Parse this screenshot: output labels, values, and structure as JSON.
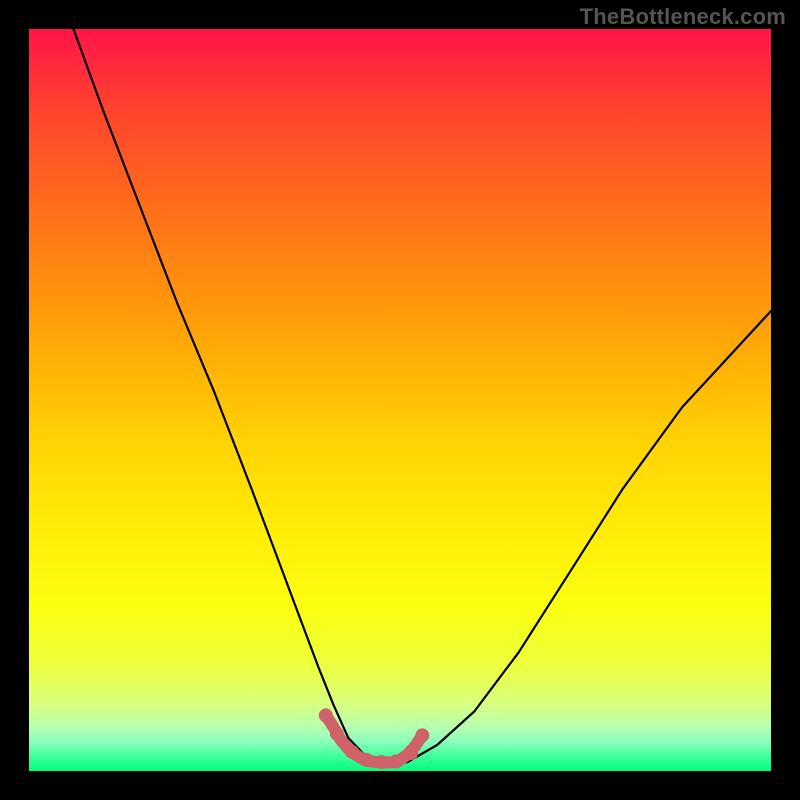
{
  "watermark": "TheBottleneck.com",
  "chart_data": {
    "type": "line",
    "title": "",
    "xlabel": "",
    "ylabel": "",
    "xlim": [
      0,
      100
    ],
    "ylim": [
      0,
      100
    ],
    "grid": false,
    "legend": false,
    "series": [
      {
        "name": "black-curve",
        "color": "#000000",
        "x": [
          6,
          10,
          15,
          20,
          25,
          30,
          33,
          36,
          39,
          41,
          43,
          45,
          47,
          49,
          51,
          55,
          60,
          66,
          73,
          80,
          88,
          100
        ],
        "y": [
          100,
          89,
          76,
          63,
          51,
          38,
          30,
          22,
          14,
          9,
          4.5,
          2.4,
          1.2,
          1.0,
          1.2,
          3.5,
          8,
          16,
          27,
          38,
          49,
          62
        ]
      },
      {
        "name": "red-overlay",
        "color": "#cf6168",
        "x": [
          40,
          41,
          42,
          43,
          44,
          45,
          46,
          47,
          48,
          49,
          50,
          51,
          52,
          53
        ],
        "y": [
          7.5,
          6.0,
          4.2,
          3.0,
          2.2,
          1.6,
          1.3,
          1.2,
          1.15,
          1.2,
          1.5,
          2.2,
          3.3,
          4.8
        ]
      }
    ],
    "overlay_points": {
      "name": "red-dots",
      "color": "#cf6168",
      "x": [
        40,
        41.5,
        43.5,
        45.5,
        47.5,
        49.5,
        51.5,
        53
      ],
      "y": [
        7.5,
        5.0,
        2.6,
        1.5,
        1.2,
        1.3,
        2.4,
        4.8
      ]
    },
    "gradient_stops": [
      {
        "pos": 0,
        "color": "#ff144a"
      },
      {
        "pos": 25,
        "color": "#ff7018"
      },
      {
        "pos": 55,
        "color": "#ffd104"
      },
      {
        "pos": 80,
        "color": "#f3ff20"
      },
      {
        "pos": 94,
        "color": "#b7ffb0"
      },
      {
        "pos": 100,
        "color": "#00ff80"
      }
    ]
  }
}
